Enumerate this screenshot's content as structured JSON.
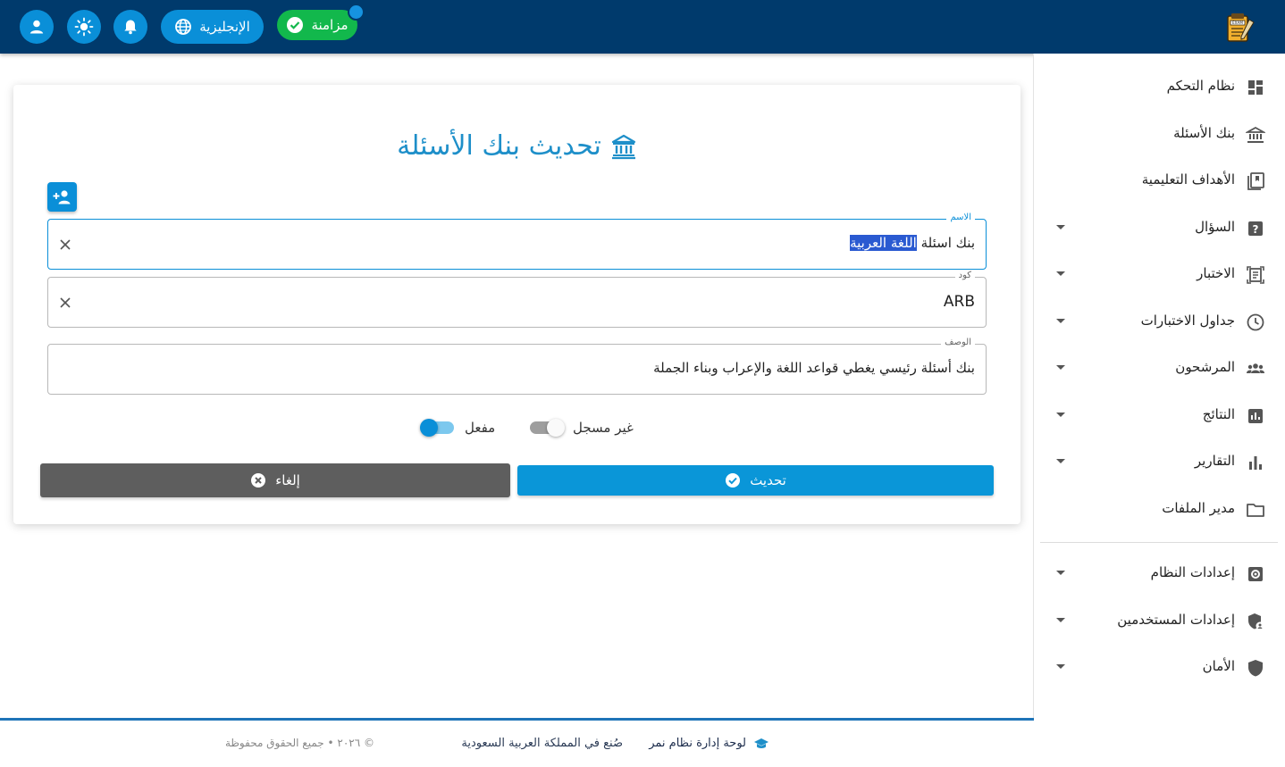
{
  "header": {
    "sync_label": "مزامنة",
    "language_label": "الإنجليزية",
    "icons": [
      "user-icon",
      "sun-icon",
      "bell-icon",
      "globe-icon",
      "check-circle-icon"
    ]
  },
  "sidebar": {
    "items": [
      {
        "label": "نظام التحكم",
        "icon": "dashboard-icon",
        "caret": false
      },
      {
        "label": "بنك الأسئلة",
        "icon": "bank-icon",
        "caret": false
      },
      {
        "label": "الأهداف التعليمية",
        "icon": "book-icon",
        "caret": false
      },
      {
        "label": "السؤال",
        "icon": "question-icon",
        "caret": true
      },
      {
        "label": "الاختبار",
        "icon": "exam-icon",
        "caret": true
      },
      {
        "label": "جداول الاختبارات",
        "icon": "clock-icon",
        "caret": true
      },
      {
        "label": "المرشحون",
        "icon": "people-icon",
        "caret": true
      },
      {
        "label": "النتائج",
        "icon": "results-icon",
        "caret": true
      },
      {
        "label": "التقارير",
        "icon": "reports-icon",
        "caret": true
      },
      {
        "label": "مدير الملفات",
        "icon": "folder-icon",
        "caret": false
      },
      {
        "label": "إعدادات النظام",
        "icon": "settings-icon",
        "caret": true
      },
      {
        "label": "إعدادات المستخدمين",
        "icon": "user-shield-icon",
        "caret": true
      },
      {
        "label": "الأمان",
        "icon": "shield-icon",
        "caret": true
      }
    ]
  },
  "form": {
    "title": "تحديث بنك الأسئلة",
    "name": {
      "label": "الاسم",
      "value_plain": "بنك اسئلة ",
      "value_selected": "اللغة العربية"
    },
    "code": {
      "label": "كود",
      "value": "ARB"
    },
    "description": {
      "label": "الوصف",
      "value": "بنك أسئلة رئيسي يغطي قواعد اللغة والإعراب وبناء الجملة"
    },
    "toggle_registered": {
      "label": "غير مسجل",
      "on": false
    },
    "toggle_active": {
      "label": "مفعل",
      "on": true
    },
    "update_label": "تحديث",
    "cancel_label": "إلغاء"
  },
  "footer": {
    "brand": "لوحة إدارة نظام نمر",
    "made_in": "صُنع في المملكة العربية السعودية",
    "copyright": "© ٢٠٢٦ • جميع الحقوق محفوظة"
  },
  "colors": {
    "header_bg": "#003a6c",
    "accent": "#0a8fd8",
    "sync_green": "#12b84c",
    "cancel_gray": "#5e5e5e",
    "title_blue": "#1e8fc9"
  }
}
